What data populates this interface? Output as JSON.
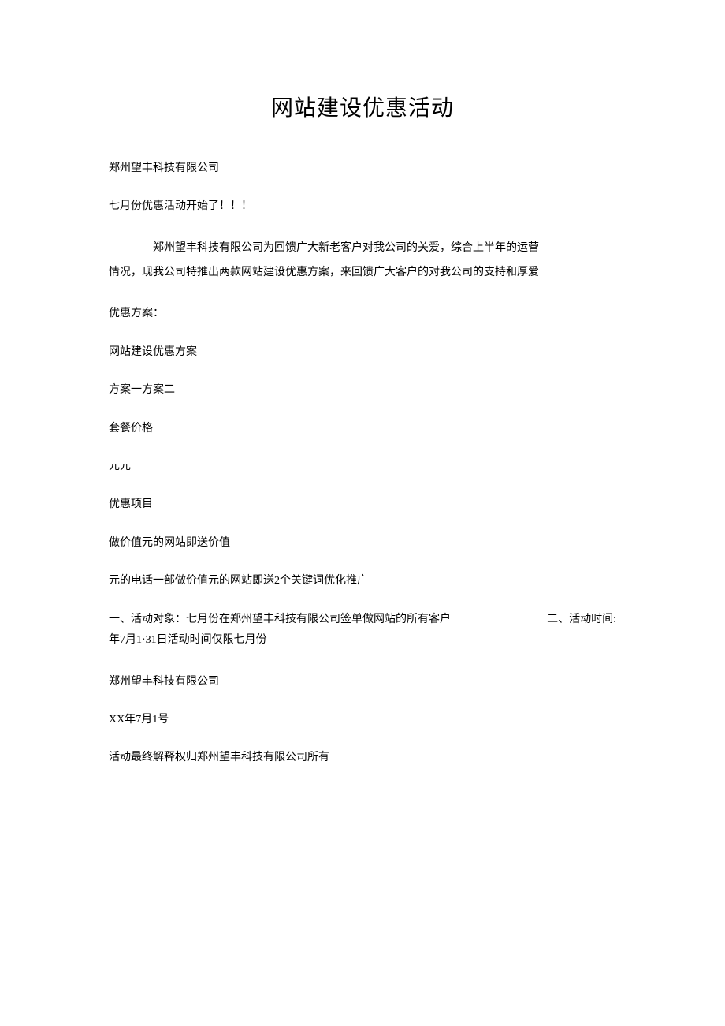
{
  "title": "网站建设优惠活动",
  "company": "郑州望丰科技有限公司",
  "announce": "七月份优惠活动开始了！！！",
  "intro_line1": "郑州望丰科技有限公司为回馈广大新老客户对我公司的关爱，综合上半年的运营",
  "intro_line2": "情况，现我公司特推出两款网站建设优惠方案，来回馈广大客户的对我公司的支持和厚爱",
  "plan_label": "优惠方案：",
  "plan_header": "网站建设优惠方案",
  "plan_options": "方案一方案二",
  "price_label": "套餐价格",
  "price_value": "元元",
  "promo_label": "优惠项目",
  "promo_line1": "做价值元的网站即送价值",
  "promo_line2": "元的电话一部做价值元的网站即送2个关键词优化推广",
  "activity_target": "一、活动对象：七月份在郑州望丰科技有限公司签单做网站的所有客户",
  "activity_time_label": "二、活动时间:",
  "activity_time_value": "年7月1·31日活动时间仅限七月份",
  "signoff_company": "郑州望丰科技有限公司",
  "signoff_date": "XX年7月1号",
  "disclaimer": "活动最终解释权归郑州望丰科技有限公司所有"
}
